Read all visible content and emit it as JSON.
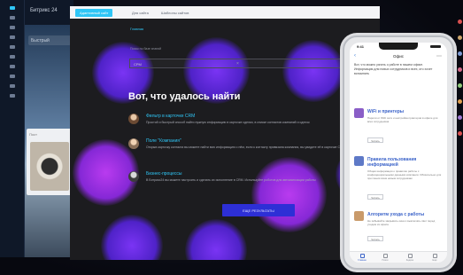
{
  "bitrix": {
    "app_title": "Битрикс 24",
    "search_placeholder": "Быстрый",
    "card_text": "Пост"
  },
  "site": {
    "tabs": [
      {
        "label": "Адаптивный сайт",
        "active": true
      },
      {
        "label": "Для сайта"
      },
      {
        "label": "Шаблоны сайтов"
      }
    ],
    "breadcrumb": "Главная",
    "search_label": "Поиск по базе знаний",
    "search_value": "СРМ",
    "heading": "Вот, что удалось найти",
    "results": [
      {
        "title": "Фильтр в карточке CRM",
        "text": "Простой и быстрый способ найти нужную информацию в карточке сделки, в списке контактов компаний и сделок"
      },
      {
        "title": "Поле \"Компания\"",
        "text": "Открыв карточку контакта вы можете найти всю информацию о нём, если к контакту привязана компания, вы увидите её в карточке CRM"
      },
      {
        "title": "Бизнес-процессы",
        "text": "В Битрикс24 вы можете настроить и сделать их исполнение в CRM. Используйте роботов для автоматизации работы"
      }
    ],
    "more_button": "ЕЩЕ РЕЗУЛЬТАТЫ",
    "accent_color": "#2fc6f6"
  },
  "phone": {
    "time": "9:41",
    "title": "Офис",
    "back_label": "‹",
    "intro": "Вот, что можно узнать о работе в нашем офисе. Информация для новых сотрудников и всех, кто хочет вспомнить",
    "cards": [
      {
        "title": "WiFi и принтеры",
        "text": "Пароли от WiFi сети и настройка принтеров в офисе для всех сотрудников",
        "button": "Читать"
      },
      {
        "title": "Правила пользования информацией",
        "text": "Общая информация о правилах работы с конфиденциальными данными компании. Обязательно для прочтения всем новым сотрудникам",
        "button": "Читать"
      },
      {
        "title": "Алгоритм ухода с работы",
        "text": "Не забывайте закрывать окна и выключать свет перед уходом из офиса",
        "button": "Читать"
      }
    ],
    "tabs": [
      {
        "label": "Главная",
        "active": true
      },
      {
        "label": "Поиск"
      },
      {
        "label": "Задачи"
      },
      {
        "label": "Ещё"
      }
    ]
  }
}
